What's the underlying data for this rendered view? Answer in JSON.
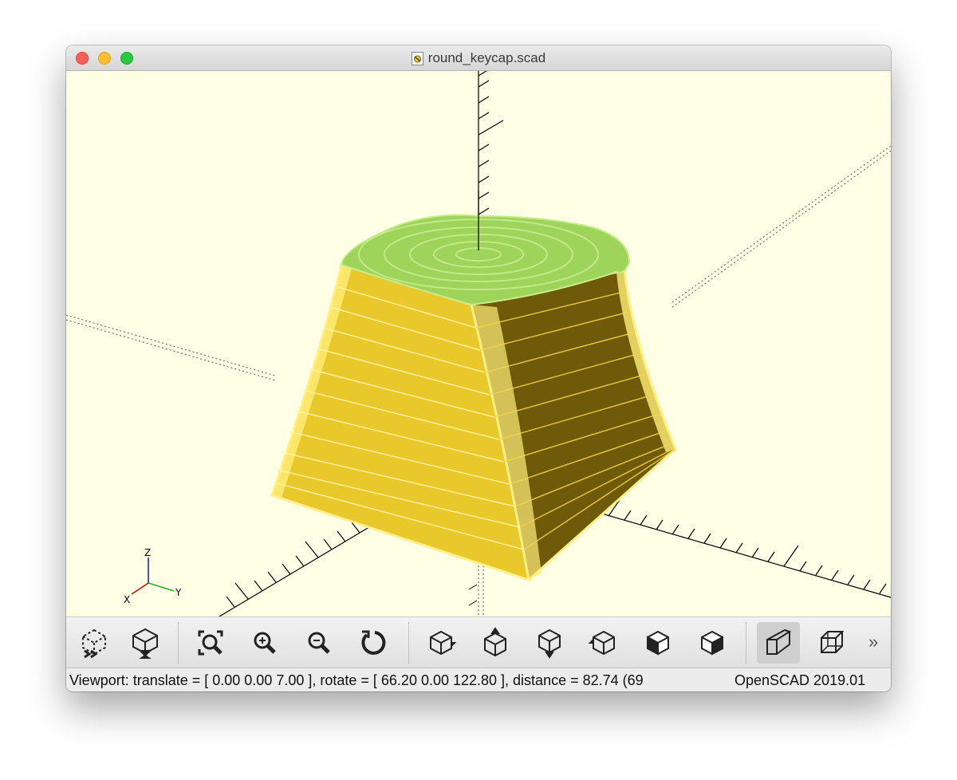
{
  "window": {
    "title": "round_keycap.scad"
  },
  "viewport": {
    "axis_labels": {
      "x": "X",
      "y": "Y",
      "z": "Z"
    },
    "colors": {
      "background": "#ffffe5",
      "model_top": "#9ed45a",
      "model_side_light": "#e9c82c",
      "model_side_dark": "#6e5a08",
      "edge_highlight": "#fff08a"
    }
  },
  "toolbar": {
    "buttons": [
      {
        "name": "preview",
        "icon": "preview-cube-icon"
      },
      {
        "name": "render",
        "icon": "render-cube-hourglass-icon"
      },
      {
        "name": "view-all",
        "icon": "zoom-all-icon"
      },
      {
        "name": "zoom-in",
        "icon": "zoom-in-icon"
      },
      {
        "name": "zoom-out",
        "icon": "zoom-out-icon"
      },
      {
        "name": "reset-view",
        "icon": "reset-view-icon"
      },
      {
        "name": "view-right",
        "icon": "view-right-icon"
      },
      {
        "name": "view-top",
        "icon": "view-top-icon"
      },
      {
        "name": "view-bottom",
        "icon": "view-bottom-icon"
      },
      {
        "name": "view-left",
        "icon": "view-left-icon"
      },
      {
        "name": "view-front",
        "icon": "view-front-icon"
      },
      {
        "name": "view-back",
        "icon": "view-back-icon"
      },
      {
        "name": "perspective",
        "icon": "perspective-icon",
        "active": true
      },
      {
        "name": "orthogonal",
        "icon": "orthogonal-icon"
      }
    ],
    "overflow_label": "»"
  },
  "status": {
    "viewport_text": "Viewport: translate = [ 0.00 0.00 7.00 ], rotate = [ 66.20 0.00 122.80 ], distance = 82.74 (69",
    "version_text": "OpenSCAD 2019.01"
  }
}
